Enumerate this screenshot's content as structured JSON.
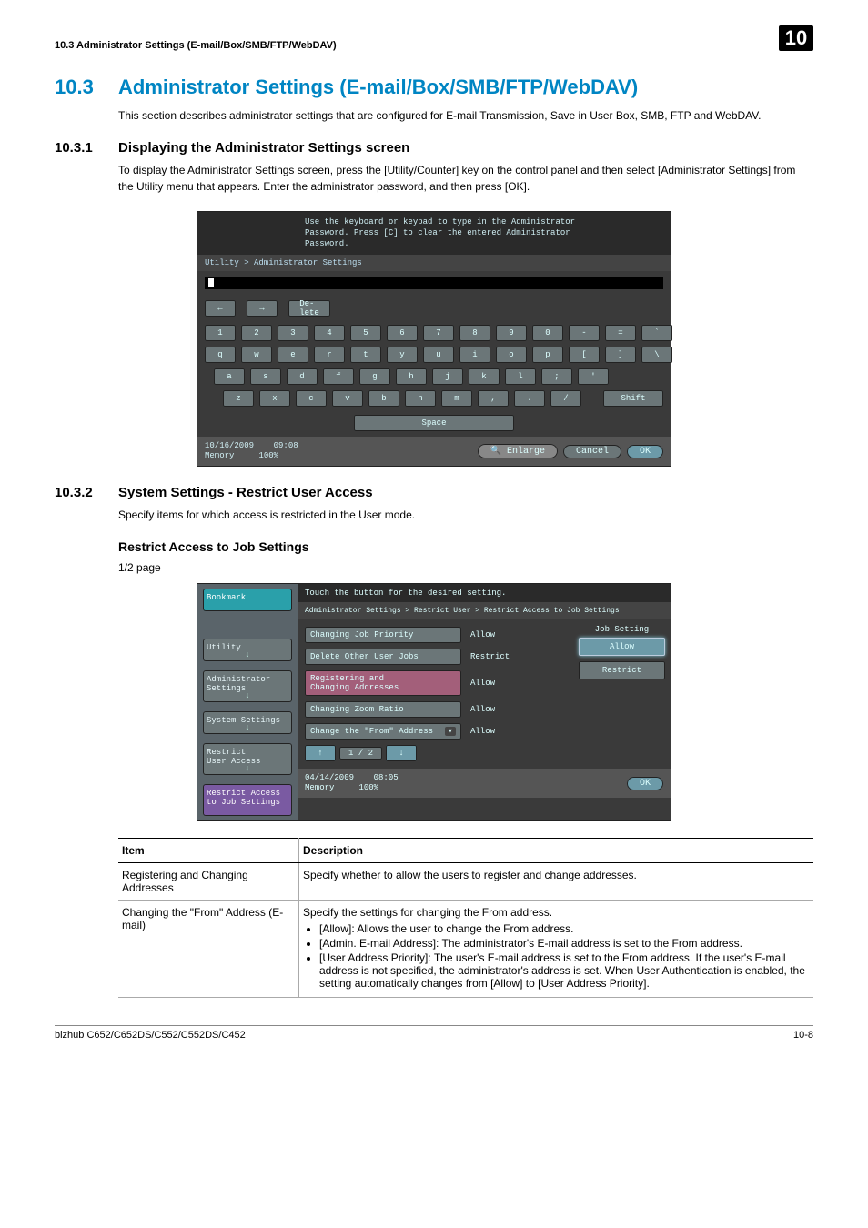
{
  "header": {
    "running": "10.3    Administrator Settings (E-mail/Box/SMB/FTP/WebDAV)",
    "chapter": "10"
  },
  "h1": {
    "num": "10.3",
    "title": "Administrator Settings (E-mail/Box/SMB/FTP/WebDAV)"
  },
  "intro": "This section describes administrator settings that are configured for E-mail Transmission, Save in User Box, SMB, FTP and WebDAV.",
  "s1": {
    "num": "10.3.1",
    "title": "Displaying the Administrator Settings screen",
    "body": "To display the Administrator Settings screen, press the [Utility/Counter] key on the control panel and then select [Administrator Settings] from the Utility menu that appears. Enter the administrator password, and then press [OK].",
    "panel": {
      "msg1": "Use the keyboard or keypad to type in the Administrator",
      "msg2": "Password.  Press [C] to clear the entered Administrator",
      "msg3": "Password.",
      "breadcrumb": "Utility > Administrator Settings",
      "delete": "De-\nlete",
      "row1": [
        "1",
        "2",
        "3",
        "4",
        "5",
        "6",
        "7",
        "8",
        "9",
        "0",
        "-",
        "=",
        "`"
      ],
      "row2": [
        "q",
        "w",
        "e",
        "r",
        "t",
        "y",
        "u",
        "i",
        "o",
        "p",
        "[",
        "]",
        "\\"
      ],
      "row3": [
        "a",
        "s",
        "d",
        "f",
        "g",
        "h",
        "j",
        "k",
        "l",
        ";",
        "'"
      ],
      "row4": [
        "z",
        "x",
        "c",
        "v",
        "b",
        "n",
        "m",
        ",",
        ".",
        "/"
      ],
      "shift": "Shift",
      "space": "Space",
      "footer_date": "10/16/2009",
      "footer_time": "09:08",
      "footer_mem_label": "Memory",
      "footer_mem_val": "100%",
      "enlarge": "Enlarge",
      "cancel": "Cancel",
      "ok": "OK"
    }
  },
  "s2": {
    "num": "10.3.2",
    "title": "System Settings - Restrict User Access",
    "body": "Specify items for which access is restricted in the User mode.",
    "h3": "Restrict Access to Job Settings",
    "pagelabel": "1/2 page",
    "panel": {
      "topmsg": "Touch the button for the desired setting.",
      "breadcrumb": "Administrator Settings > Restrict User > Restrict Access to Job Settings",
      "side": {
        "bookmark": "Bookmark",
        "utility": "Utility",
        "admin": "Administrator\nSettings",
        "system": "System Settings",
        "restrict": "Restrict\nUser Access",
        "restrict_access": "Restrict Access\nto Job Settings"
      },
      "rows": [
        {
          "label": "Changing Job Priority",
          "value": "Allow"
        },
        {
          "label": "Delete Other User Jobs",
          "value": "Restrict"
        },
        {
          "label": "Registering and\nChanging Addresses",
          "value": "Allow"
        },
        {
          "label": "Changing Zoom Ratio",
          "value": "Allow"
        },
        {
          "label": "Change the \"From\" Address",
          "value": "Allow"
        }
      ],
      "right": {
        "heading": "Job Setting",
        "allow": "Allow",
        "restrict": "Restrict"
      },
      "pager": "1 / 2",
      "footer_date": "04/14/2009",
      "footer_time": "08:05",
      "footer_mem_label": "Memory",
      "footer_mem_val": "100%",
      "ok": "OK"
    }
  },
  "table": {
    "h_item": "Item",
    "h_desc": "Description",
    "r1_item": "Registering and Changing Addresses",
    "r1_desc": "Specify whether to allow the users to register and change addresses.",
    "r2_item": "Changing the \"From\" Address (E-mail)",
    "r2_desc_lead": "Specify the settings for changing the From address.",
    "r2_b1": "[Allow]: Allows the user to change the From address.",
    "r2_b2": "[Admin. E-mail Address]: The administrator's E-mail address is set to the From address.",
    "r2_b3": "[User Address Priority]: The user's E-mail address is set to the From address. If the user's E-mail address is not specified, the administrator's address is set. When User Authentication is enabled, the setting automatically changes from [Allow] to [User Address Priority]."
  },
  "footer": {
    "left": "bizhub C652/C652DS/C552/C552DS/C452",
    "right": "10-8"
  }
}
